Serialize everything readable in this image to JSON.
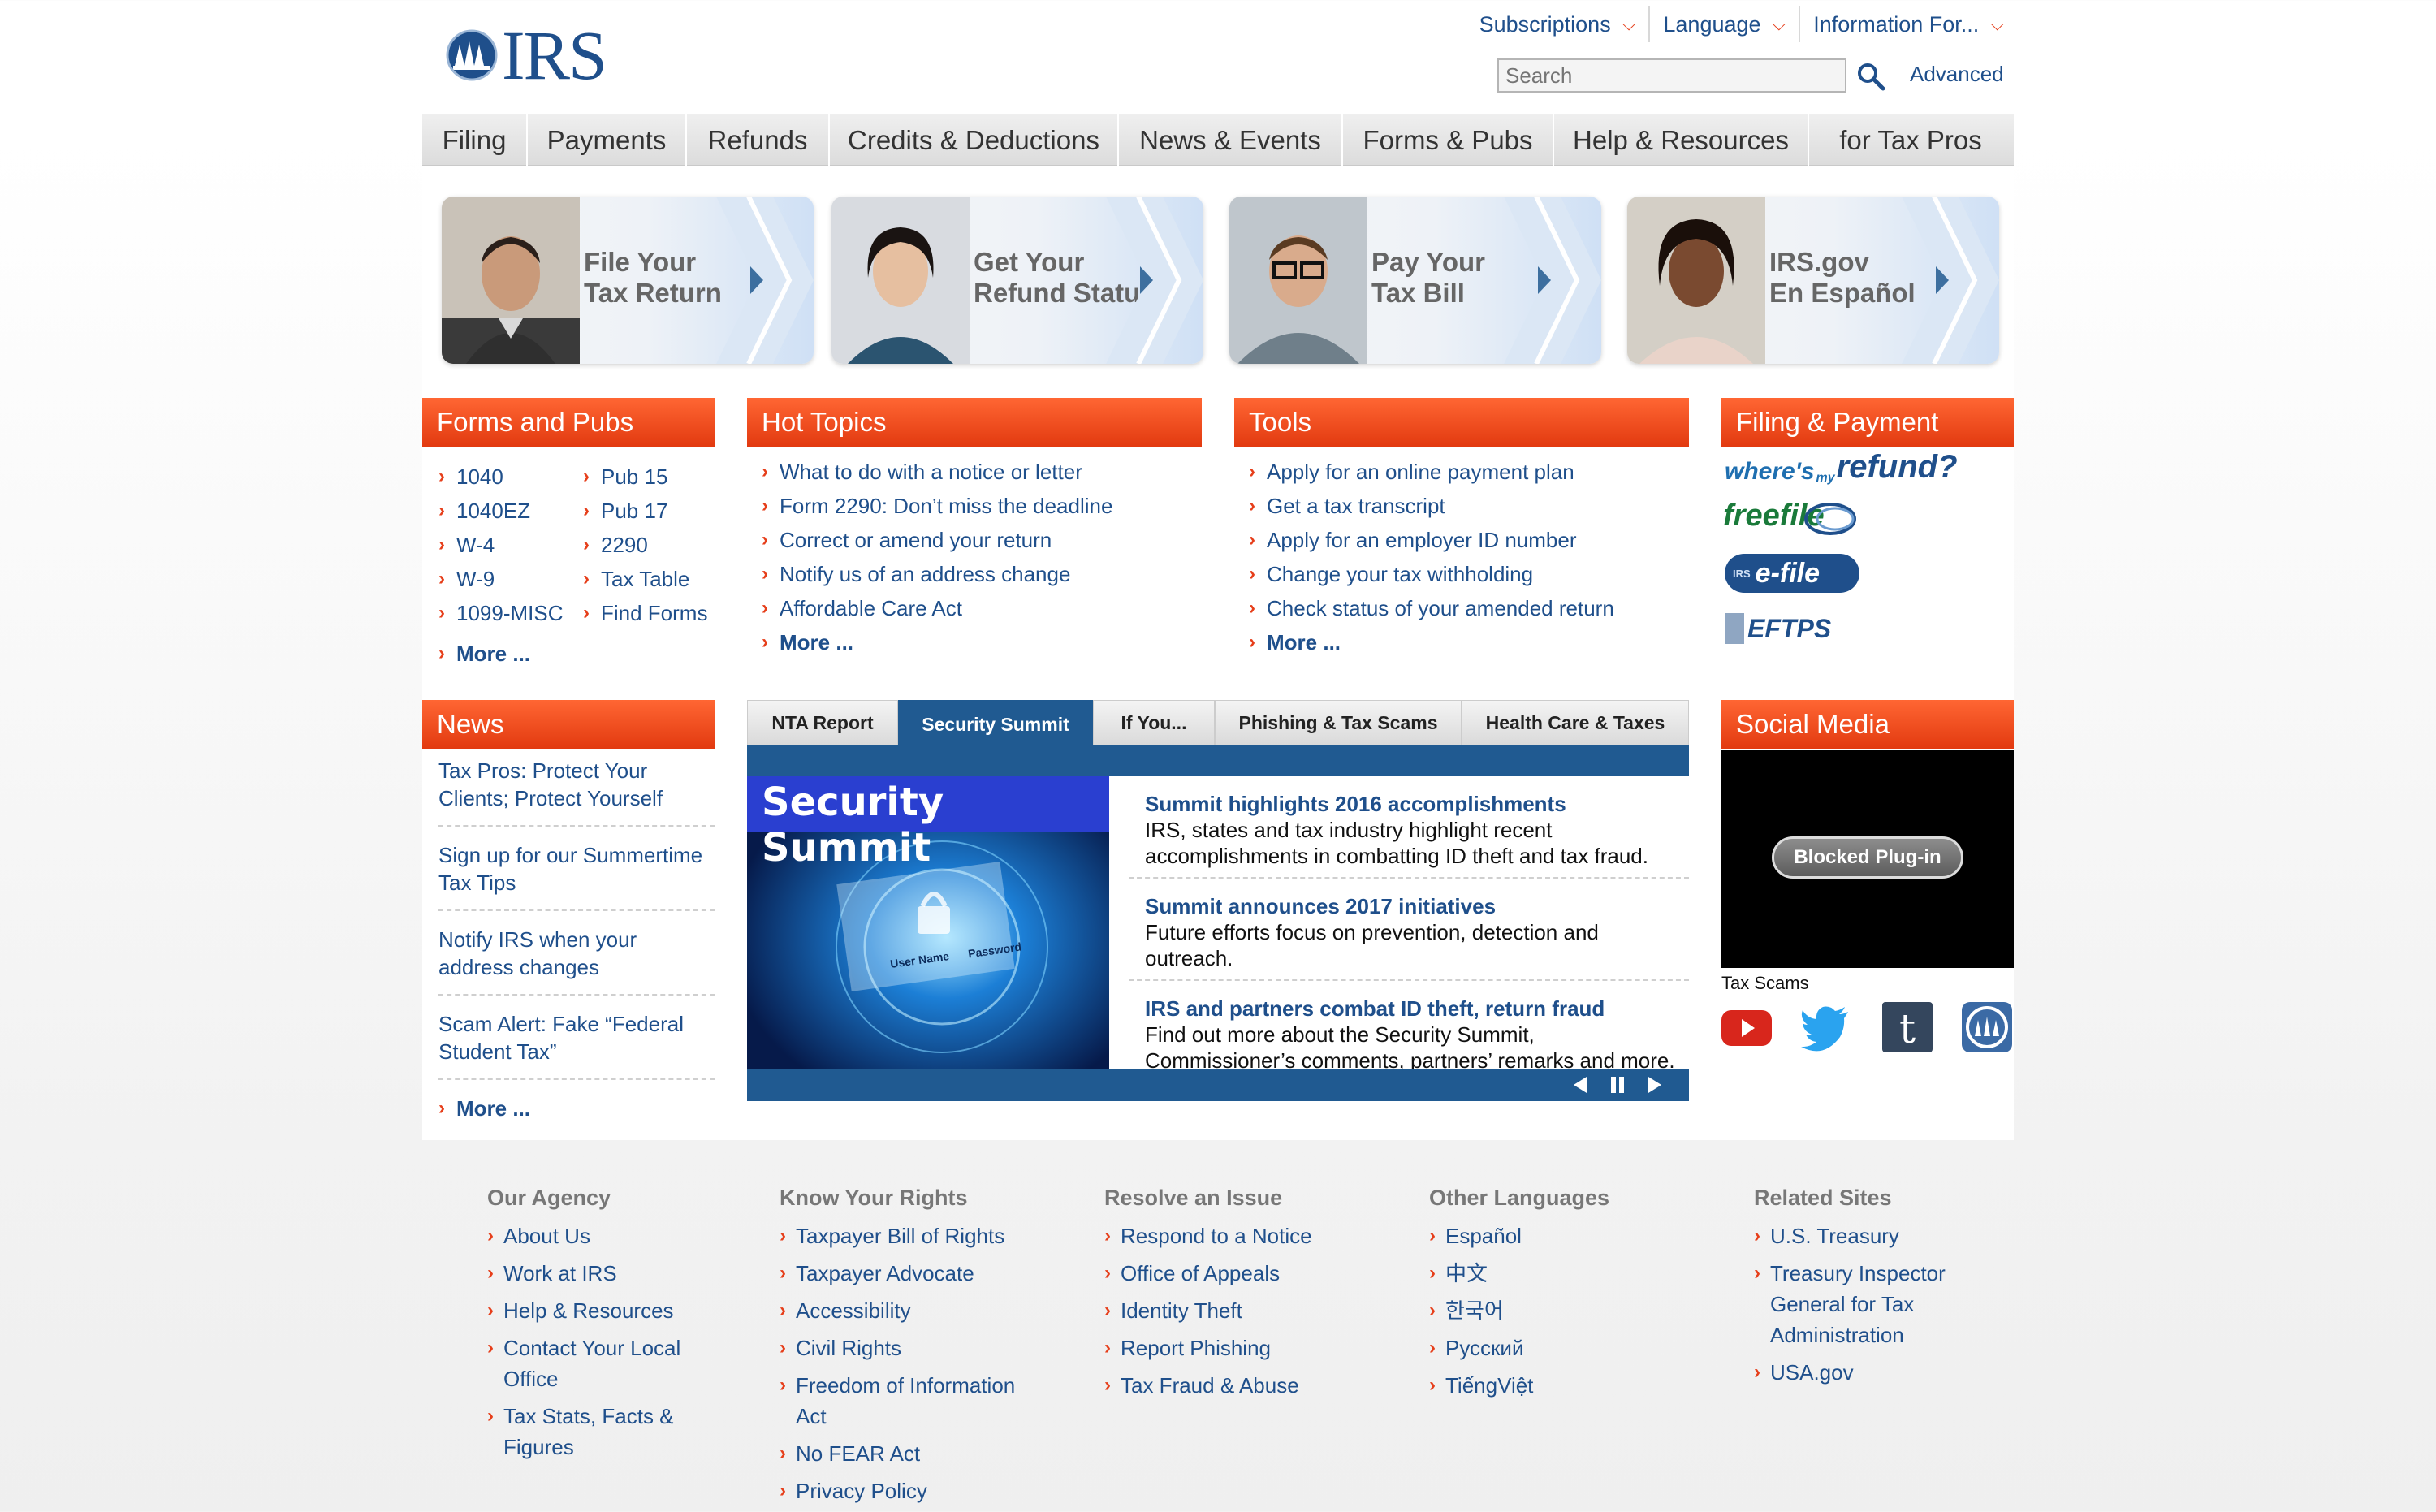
{
  "header": {
    "logo_text": "IRS",
    "utility": [
      {
        "label": "Subscriptions"
      },
      {
        "label": "Language"
      },
      {
        "label": "Information For..."
      }
    ],
    "search_placeholder": "Search",
    "advanced_label": "Advanced"
  },
  "nav": [
    {
      "label": "Filing"
    },
    {
      "label": "Payments"
    },
    {
      "label": "Refunds"
    },
    {
      "label": "Credits & Deductions"
    },
    {
      "label": "News & Events"
    },
    {
      "label": "Forms & Pubs"
    },
    {
      "label": "Help & Resources"
    },
    {
      "label": "for Tax Pros"
    }
  ],
  "promos": [
    {
      "label": "File Your\nTax Return"
    },
    {
      "label": "Get Your\nRefund Status"
    },
    {
      "label": "Pay Your\nTax Bill"
    },
    {
      "label": "IRS.gov\nEn Español"
    }
  ],
  "forms_pubs": {
    "title": "Forms and Pubs",
    "col1": [
      "1040",
      "1040EZ",
      "W-4",
      "W-9",
      "1099-MISC"
    ],
    "col2": [
      "Pub 15",
      "Pub 17",
      "2290",
      "Tax Table",
      "Find Forms"
    ],
    "more": "More ..."
  },
  "hot_topics": {
    "title": "Hot Topics",
    "items": [
      "What to do with a notice or letter",
      "Form 2290: Don’t miss the deadline",
      "Correct or amend your return",
      "Notify us of an address change",
      "Affordable Care Act"
    ],
    "more": "More ..."
  },
  "tools": {
    "title": "Tools",
    "items": [
      "Apply for an online payment plan",
      "Get a tax transcript",
      "Apply for an employer ID number",
      "Change your tax withholding",
      "Check status of your amended return"
    ],
    "more": "More ..."
  },
  "filing_payment": {
    "title": "Filing & Payment",
    "logos": {
      "wheres": "where's",
      "my": "my",
      "refund": "refund?",
      "freefile": "freefile",
      "efile_prefix": "IRS",
      "efile": "e-file",
      "eftps": "EFTPS"
    }
  },
  "news": {
    "title": "News",
    "items": [
      "Tax Pros: Protect Your Clients; Protect Yourself",
      "Sign up for our Summertime Tax Tips",
      "Notify IRS when your address changes",
      "Scam Alert: Fake “Federal Student Tax”"
    ],
    "more": "More ..."
  },
  "tabs": [
    {
      "label": "NTA Report",
      "active": false
    },
    {
      "label": "Security Summit",
      "active": true
    },
    {
      "label": "If You...",
      "active": false
    },
    {
      "label": "Phishing & Tax Scams",
      "active": false
    },
    {
      "label": "Health Care & Taxes",
      "active": false
    }
  ],
  "feature": {
    "image_title": "Security Summit",
    "image_fields": [
      "User Name",
      "Password"
    ],
    "items": [
      {
        "title": "Summit highlights 2016 accomplishments",
        "desc": "IRS, states and tax industry highlight recent accomplishments in combatting ID theft and tax fraud."
      },
      {
        "title": "Summit announces 2017 initiatives",
        "desc": "Future efforts focus on prevention, detection and outreach."
      },
      {
        "title": "IRS and partners combat ID theft, return fraud",
        "desc": "Find out more about the Security Summit, Commissioner’s comments, partners’ remarks and more."
      }
    ]
  },
  "social": {
    "title": "Social Media",
    "blocked_label": "Blocked Plug-in",
    "caption": "Tax Scams",
    "icons": [
      "youtube-icon",
      "twitter-icon",
      "tumblr-icon",
      "irs-seal-icon"
    ]
  },
  "footer": [
    {
      "title": "Our Agency",
      "links": [
        "About Us",
        "Work at IRS",
        "Help & Resources",
        "Contact Your Local Office",
        "Tax Stats, Facts & Figures"
      ]
    },
    {
      "title": "Know Your Rights",
      "links": [
        "Taxpayer Bill of Rights",
        "Taxpayer Advocate",
        "Accessibility",
        "Civil Rights",
        "Freedom of Information Act",
        "No FEAR Act",
        "Privacy Policy"
      ]
    },
    {
      "title": "Resolve an Issue",
      "links": [
        "Respond to a Notice",
        "Office of Appeals",
        "Identity Theft",
        "Report Phishing",
        "Tax Fraud & Abuse"
      ]
    },
    {
      "title": "Other Languages",
      "links": [
        "Español",
        "中文",
        "한국어",
        "Русский",
        "TiếngViệt"
      ]
    },
    {
      "title": "Related Sites",
      "links": [
        "U.S. Treasury",
        "Treasury Inspector General for Tax Administration",
        "USA.gov"
      ]
    }
  ],
  "colors": {
    "brand_blue": "#1f4f8b",
    "header_orange": "#e23a10",
    "tab_blue": "#205a91"
  }
}
